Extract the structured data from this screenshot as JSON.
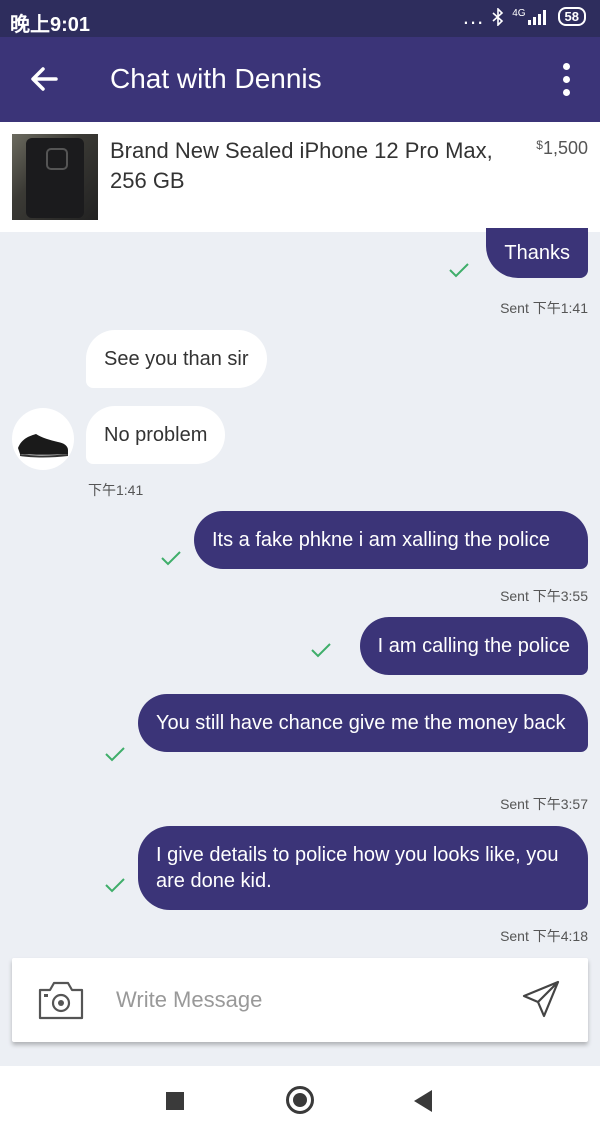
{
  "status_bar": {
    "time": "晚上9:01",
    "dots": "...",
    "signal_label": "4G",
    "battery": "58"
  },
  "header": {
    "title": "Chat with Dennis"
  },
  "listing": {
    "title": "Brand New Sealed iPhone 12 Pro Max, 256 GB",
    "currency": "$",
    "price": "1,500"
  },
  "messages": [
    {
      "direction": "out",
      "text": "Thanks",
      "read": true
    },
    {
      "direction": "meta",
      "text": "Sent 下午1:41"
    },
    {
      "direction": "in",
      "text": "See you than sir"
    },
    {
      "direction": "in",
      "text": "No problem"
    },
    {
      "direction": "meta",
      "text": "下午1:41"
    },
    {
      "direction": "out",
      "text": "Its a fake phkne i am xalling the police",
      "read": true
    },
    {
      "direction": "meta",
      "text": "Sent 下午3:55"
    },
    {
      "direction": "out",
      "text": "I am calling the police",
      "read": true
    },
    {
      "direction": "out",
      "text": "You still have chance give me the money back",
      "read": true
    },
    {
      "direction": "meta",
      "text": "Sent 下午3:57"
    },
    {
      "direction": "out",
      "text": "I give details to police how you looks like, you are done kid.",
      "read": true
    },
    {
      "direction": "meta",
      "text": "Sent 下午4:18"
    }
  ],
  "composer": {
    "placeholder": "Write Message"
  },
  "colors": {
    "status_bar": "#2e2d5d",
    "app_bar": "#3b3478",
    "outgoing_bubble": "#3b3478",
    "incoming_bubble": "#ffffff",
    "read_check": "#3fae6a",
    "background": "#eceff4"
  },
  "icons": {
    "back": "arrow-left-icon",
    "menu": "more-vert-icon",
    "camera": "camera-icon",
    "send": "send-icon",
    "read": "check-icon"
  }
}
